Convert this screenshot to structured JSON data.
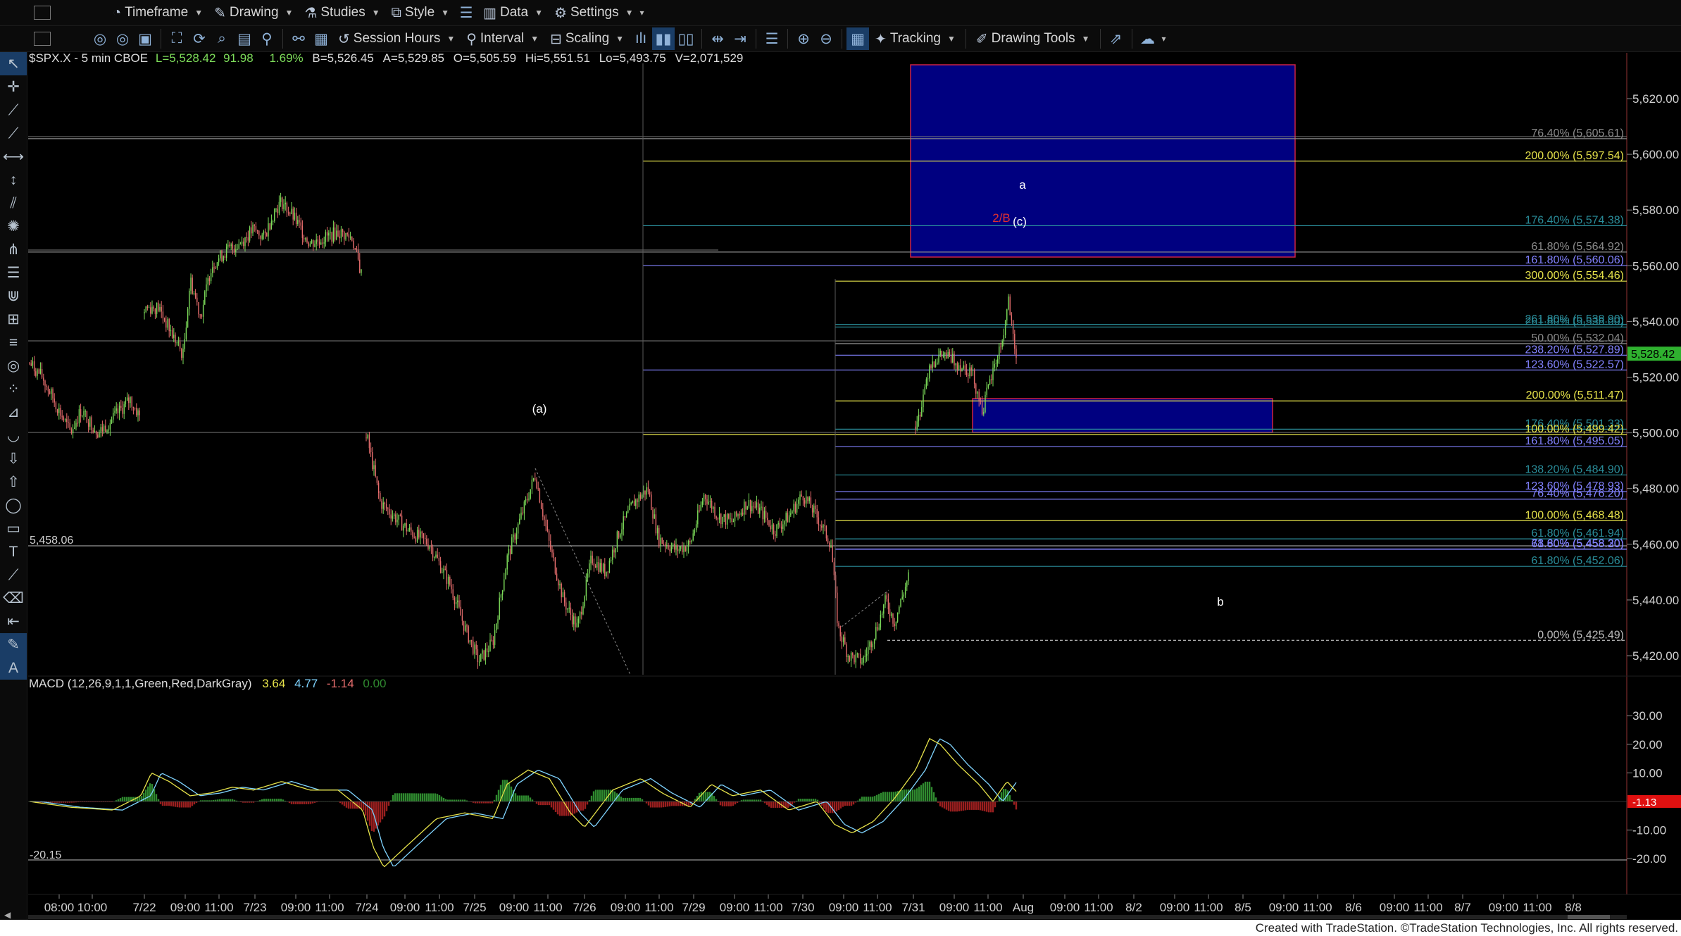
{
  "toolbar1": {
    "timeframe": "Timeframe",
    "drawing": "Drawing",
    "studies": "Studies",
    "style": "Style",
    "data": "Data",
    "settings": "Settings"
  },
  "toolbar2": {
    "session_hours": "Session Hours",
    "interval": "Interval",
    "scaling": "Scaling",
    "tracking": "Tracking",
    "drawing_tools": "Drawing Tools"
  },
  "header": {
    "symbol": "$SPX.X - 5 min  CBOE",
    "last": "L=5,528.42",
    "change": "91.98",
    "pct": "1.69%",
    "bid": "B=5,526.45",
    "ask": "A=5,529.85",
    "open": "O=5,505.59",
    "high": "Hi=5,551.51",
    "low": "Lo=5,493.75",
    "volume": "V=2,071,529"
  },
  "price_axis": {
    "ticks": [
      "5,620.00",
      "5,600.00",
      "5,580.00",
      "5,560.00",
      "5,540.00",
      "5,520.00",
      "5,500.00",
      "5,480.00",
      "5,460.00",
      "5,440.00",
      "5,420.00"
    ],
    "tick_values": [
      5620,
      5600,
      5580,
      5560,
      5540,
      5520,
      5500,
      5480,
      5460,
      5440,
      5420
    ],
    "last_price": "5,528.42",
    "ref_line": "5,458.06"
  },
  "fib_levels": [
    {
      "label": "76.40% (5,605.61)",
      "value": 5605.61,
      "color": "#8a8a8a"
    },
    {
      "label": "200.00% (5,597.54)",
      "value": 5597.54,
      "color": "#e6e24a"
    },
    {
      "label": "176.40% (5,574.38)",
      "value": 5574.38,
      "color": "#2a8d9a"
    },
    {
      "label": "61.80% (5,564.92)",
      "value": 5564.92,
      "color": "#8a8a8a"
    },
    {
      "label": "161.80% (5,560.06)",
      "value": 5560.06,
      "color": "#8282ff"
    },
    {
      "label": "300.00% (5,554.46)",
      "value": 5554.46,
      "color": "#e6e24a"
    },
    {
      "label": "261.80% (5,538.90)",
      "value": 5538.9,
      "color": "#2a8d9a"
    },
    {
      "label": "261.80% (5,538.00)",
      "value": 5538.0,
      "color": "#2a8d9a"
    },
    {
      "label": "50.00% (5,532.04)",
      "value": 5532.04,
      "color": "#8a8a8a"
    },
    {
      "label": "238.20% (5,527.89)",
      "value": 5527.89,
      "color": "#8282ff"
    },
    {
      "label": "123.60% (5,522.57)",
      "value": 5522.57,
      "color": "#8282ff"
    },
    {
      "label": "200.00% (5,511.47)",
      "value": 5511.47,
      "color": "#e6e24a"
    },
    {
      "label": "176.40% (5,501.33)",
      "value": 5501.33,
      "color": "#2a8d9a"
    },
    {
      "label": "100.00% (5,499.42)",
      "value": 5499.42,
      "color": "#e6e24a"
    },
    {
      "label": "161.80% (5,495.05)",
      "value": 5495.05,
      "color": "#8282ff"
    },
    {
      "label": "138.20% (5,484.90)",
      "value": 5484.9,
      "color": "#2a8d9a"
    },
    {
      "label": "123.60% (5,478.93)",
      "value": 5478.93,
      "color": "#8282ff"
    },
    {
      "label": "76.40% (5,476.20)",
      "value": 5476.2,
      "color": "#8282ff"
    },
    {
      "label": "100.00% (5,468.48)",
      "value": 5468.48,
      "color": "#e6e24a"
    },
    {
      "label": "61.80% (5,461.94)",
      "value": 5461.94,
      "color": "#2a8d9a"
    },
    {
      "label": "78.60% (5,458.30)",
      "value": 5458.3,
      "color": "#8282ff"
    },
    {
      "label": "61.80% (5,458.20)",
      "value": 5458.2,
      "color": "#8282ff"
    },
    {
      "label": "61.80% (5,452.06)",
      "value": 5452.06,
      "color": "#2a8d9a"
    },
    {
      "label": "0.00% (5,425.49)",
      "value": 5425.49,
      "color": "#bdbdbd"
    }
  ],
  "wave_labels": {
    "a": "a",
    "b": "b",
    "wave_2b": "2/B",
    "wave_c": "(c)",
    "wave_a_paren": "(a)"
  },
  "macd": {
    "title": "MACD (12,26,9,1,1,Green,Red,DarkGray)",
    "v1": "3.64",
    "v2": "4.77",
    "v3": "-1.14",
    "v4": "0.00",
    "axis": [
      "30.00",
      "20.00",
      "10.00",
      "-10.00",
      "-20.00"
    ],
    "axis_values": [
      30,
      20,
      10,
      -10,
      -20
    ],
    "current": "-1.13",
    "ref_line": "-20.15"
  },
  "time_axis": [
    "08:00",
    "10:00",
    "7/22",
    "09:00",
    "11:00",
    "7/23",
    "09:00",
    "11:00",
    "7/24",
    "09:00",
    "11:00",
    "7/25",
    "09:00",
    "11:00",
    "7/26",
    "09:00",
    "11:00",
    "7/29",
    "09:00",
    "11:00",
    "7/30",
    "09:00",
    "11:00",
    "7/31",
    "09:00",
    "11:00",
    "Aug",
    "09:00",
    "11:00",
    "8/2",
    "09:00",
    "11:00",
    "8/5",
    "09:00",
    "11:00",
    "8/6",
    "09:00",
    "11:00",
    "8/7",
    "09:00",
    "11:00",
    "8/8"
  ],
  "footer": "Created with TradeStation. ©TradeStation Technologies, Inc. All rights reserved.",
  "colors": {
    "up": "#7ddc5a",
    "down": "#e86e6e",
    "zone": "#000080",
    "zone_border": "#cc2244",
    "macd_line": "#e6e24a",
    "signal_line": "#7fd4ff",
    "hist_up": "#2f8a2f",
    "hist_down": "#9a1f1f"
  }
}
